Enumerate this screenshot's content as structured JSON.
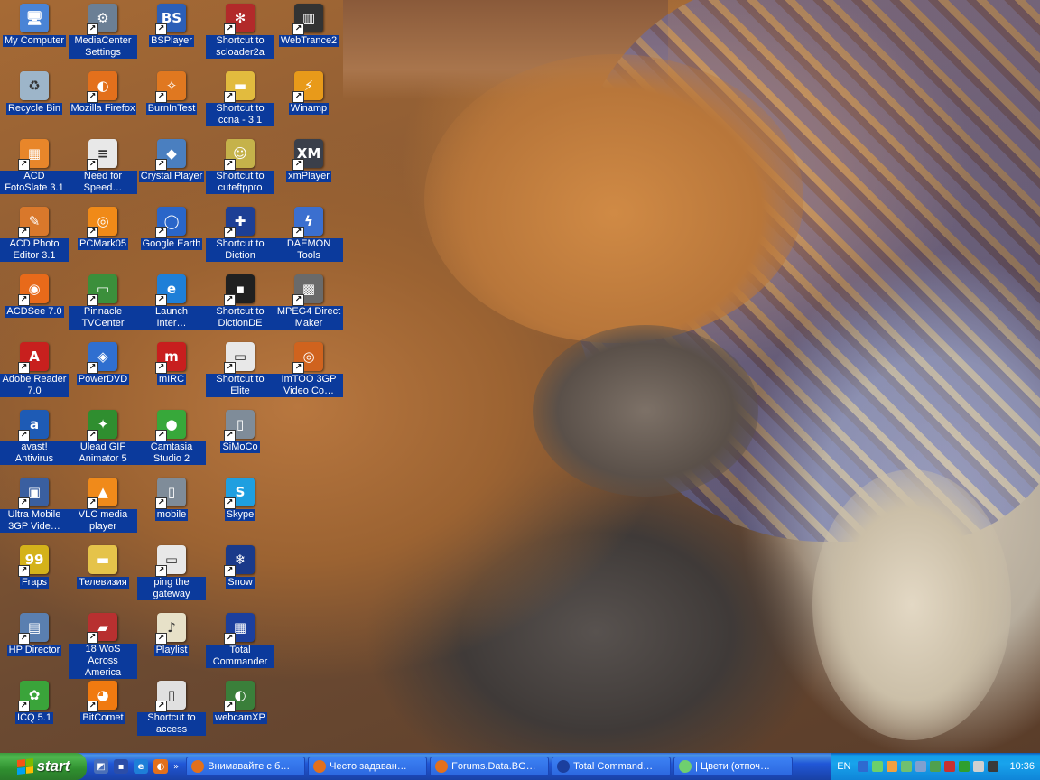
{
  "desktop": {
    "columns": [
      [
        {
          "name": "my-computer",
          "label": "My Computer",
          "color": "#4a84d6",
          "glyph": "🖥",
          "shortcut": false
        },
        {
          "name": "recycle-bin",
          "label": "Recycle Bin",
          "color": "#9db5c9",
          "glyph": "♻",
          "shortcut": false
        },
        {
          "name": "acd-fotoslate",
          "label": "ACD FotoSlate 3.1",
          "color": "#e8862a",
          "glyph": "▦",
          "shortcut": true
        },
        {
          "name": "acd-photo-editor",
          "label": "ACD Photo Editor 3.1",
          "color": "#d9782b",
          "glyph": "✎",
          "shortcut": true
        },
        {
          "name": "acdsee",
          "label": "ACDSee 7.0",
          "color": "#e86a1a",
          "glyph": "◉",
          "shortcut": true
        },
        {
          "name": "adobe-reader",
          "label": "Adobe Reader 7.0",
          "color": "#c8201e",
          "glyph": "A",
          "shortcut": true
        },
        {
          "name": "avast",
          "label": "avast! Antivirus",
          "color": "#1e5bb5",
          "glyph": "a",
          "shortcut": true
        },
        {
          "name": "ultra-mobile-3gp",
          "label": "Ultra Mobile 3GP Vide…",
          "color": "#3a5fa0",
          "glyph": "▣",
          "shortcut": true
        },
        {
          "name": "fraps",
          "label": "Fraps",
          "color": "#d4b21a",
          "glyph": "99",
          "shortcut": true
        },
        {
          "name": "hp-director",
          "label": "HP Director",
          "color": "#5a7fb0",
          "glyph": "▤",
          "shortcut": true
        },
        {
          "name": "icq",
          "label": "ICQ 5.1",
          "color": "#3aa43a",
          "glyph": "✿",
          "shortcut": true
        }
      ],
      [
        {
          "name": "mediacenter-settings",
          "label": "MediaCenter Settings",
          "color": "#6b7f95",
          "glyph": "⚙",
          "shortcut": true
        },
        {
          "name": "mozilla-firefox",
          "label": "Mozilla Firefox",
          "color": "#e3701c",
          "glyph": "◐",
          "shortcut": true
        },
        {
          "name": "need-for-speed",
          "label": "Need for Speed…",
          "color": "#e8e8e8",
          "glyph": "≡",
          "shortcut": true
        },
        {
          "name": "pcmark05",
          "label": "PCMark05",
          "color": "#f08a18",
          "glyph": "◎",
          "shortcut": true
        },
        {
          "name": "pinnacle-tvcenter",
          "label": "Pinnacle TVCenter",
          "color": "#3b8f3b",
          "glyph": "▭",
          "shortcut": true
        },
        {
          "name": "powerdvd",
          "label": "PowerDVD",
          "color": "#2f6fd0",
          "glyph": "◈",
          "shortcut": true
        },
        {
          "name": "ulead-gif-animator",
          "label": "Ulead GIF Animator 5",
          "color": "#2f8e2f",
          "glyph": "✦",
          "shortcut": true
        },
        {
          "name": "vlc-media-player",
          "label": "VLC media player",
          "color": "#f08a1a",
          "glyph": "▲",
          "shortcut": true
        },
        {
          "name": "televizia",
          "label": "Телевизия",
          "color": "#e5c34a",
          "glyph": "▬",
          "shortcut": false
        },
        {
          "name": "18-wos-across-america",
          "label": "18 WoS Across America",
          "color": "#b83030",
          "glyph": "▰",
          "shortcut": true
        },
        {
          "name": "bitcomet",
          "label": "BitComet",
          "color": "#f07a10",
          "glyph": "◕",
          "shortcut": true
        }
      ],
      [
        {
          "name": "bsplayer",
          "label": "BSPlayer",
          "color": "#2b5fb8",
          "glyph": "BS",
          "shortcut": true
        },
        {
          "name": "burnintest",
          "label": "BurnInTest",
          "color": "#e07820",
          "glyph": "✧",
          "shortcut": true
        },
        {
          "name": "crystal-player",
          "label": "Crystal Player",
          "color": "#4a7fc0",
          "glyph": "◆",
          "shortcut": true
        },
        {
          "name": "google-earth",
          "label": "Google Earth",
          "color": "#2a66c9",
          "glyph": "◯",
          "shortcut": true
        },
        {
          "name": "launch-internet",
          "label": "Launch Inter…",
          "color": "#1e7fd8",
          "glyph": "e",
          "shortcut": true
        },
        {
          "name": "mirc",
          "label": "mIRC",
          "color": "#c81e1e",
          "glyph": "m",
          "shortcut": true
        },
        {
          "name": "camtasia-studio",
          "label": "Camtasia Studio 2",
          "color": "#37a83a",
          "glyph": "●",
          "shortcut": true
        },
        {
          "name": "mobile",
          "label": "mobile",
          "color": "#7f8c99",
          "glyph": "▯",
          "shortcut": true
        },
        {
          "name": "ping-the-gateway",
          "label": "ping the gateway",
          "color": "#e8e8e8",
          "glyph": "▭",
          "shortcut": true
        },
        {
          "name": "playlist",
          "label": "Playlist",
          "color": "#e7e1c8",
          "glyph": "♪",
          "shortcut": true
        },
        {
          "name": "shortcut-to-access",
          "label": "Shortcut to access",
          "color": "#e0e0e0",
          "glyph": "▯",
          "shortcut": true
        }
      ],
      [
        {
          "name": "shortcut-to-scloader2a",
          "label": "Shortcut to scloader2a",
          "color": "#b22a2a",
          "glyph": "✻",
          "shortcut": true
        },
        {
          "name": "shortcut-to-ccna",
          "label": "Shortcut to ccna - 3.1",
          "color": "#e2bb3e",
          "glyph": "▬",
          "shortcut": true
        },
        {
          "name": "shortcut-to-cuteftppro",
          "label": "Shortcut to cuteftppro",
          "color": "#c5b24a",
          "glyph": "☺",
          "shortcut": true
        },
        {
          "name": "shortcut-to-diction",
          "label": "Shortcut to Diction",
          "color": "#1d3f95",
          "glyph": "✚",
          "shortcut": true
        },
        {
          "name": "shortcut-to-dictionde",
          "label": "Shortcut to DictionDE",
          "color": "#202020",
          "glyph": "▪",
          "shortcut": true
        },
        {
          "name": "shortcut-to-elite",
          "label": "Shortcut to Elite",
          "color": "#e8e8e8",
          "glyph": "▭",
          "shortcut": true
        },
        {
          "name": "simoco",
          "label": "SiMoCo",
          "color": "#7f8c99",
          "glyph": "▯",
          "shortcut": true
        },
        {
          "name": "skype",
          "label": "Skype",
          "color": "#1f9fe0",
          "glyph": "S",
          "shortcut": true
        },
        {
          "name": "snow",
          "label": "Snow",
          "color": "#1a3a8a",
          "glyph": "❄",
          "shortcut": true
        },
        {
          "name": "total-commander",
          "label": "Total Commander",
          "color": "#1b3f9e",
          "glyph": "▦",
          "shortcut": true
        },
        {
          "name": "webcamxp",
          "label": "webcamXP",
          "color": "#3a7f3a",
          "glyph": "◐",
          "shortcut": true
        }
      ],
      [
        {
          "name": "webtrance2",
          "label": "WebTrance2",
          "color": "#333333",
          "glyph": "▥",
          "shortcut": true
        },
        {
          "name": "winamp",
          "label": "Winamp",
          "color": "#e89a1a",
          "glyph": "⚡",
          "shortcut": true
        },
        {
          "name": "xmplayer",
          "label": "xmPlayer",
          "color": "#3a3f4a",
          "glyph": "XM",
          "shortcut": true
        },
        {
          "name": "daemon-tools",
          "label": "DAEMON Tools",
          "color": "#3b6fcf",
          "glyph": "ϟ",
          "shortcut": true
        },
        {
          "name": "mpeg4-direct-maker",
          "label": "MPEG4 Direct Maker",
          "color": "#6a6a6a",
          "glyph": "▩",
          "shortcut": true
        },
        {
          "name": "imtoo-3gp-video",
          "label": "ImTOO 3GP Video Co…",
          "color": "#d0631e",
          "glyph": "◎",
          "shortcut": true
        }
      ]
    ]
  },
  "taskbar": {
    "start_label": "start",
    "quick_launch": [
      {
        "name": "ql-media-icon",
        "color": "#4a6fb8",
        "glyph": "◩"
      },
      {
        "name": "ql-floppy-icon",
        "color": "#2b4da8",
        "glyph": "▪"
      },
      {
        "name": "ql-ie-icon",
        "color": "#1e7fd8",
        "glyph": "e"
      },
      {
        "name": "ql-firefox-icon",
        "color": "#e3701c",
        "glyph": "◐"
      }
    ],
    "quick_launch_more": "»",
    "tasks": [
      {
        "name": "task-vnimavayte",
        "label": "Внимавайте с б…",
        "color": "#e3701c"
      },
      {
        "name": "task-chesto-zadavan",
        "label": "Често задаван…",
        "color": "#e3701c"
      },
      {
        "name": "task-forums-data-bg",
        "label": "Forums.Data.BG…",
        "color": "#e3701c"
      },
      {
        "name": "task-total-commander",
        "label": "Total Command…",
        "color": "#1b3f9e"
      },
      {
        "name": "task-tsveti",
        "label": "| Цвети (отпоч…",
        "color": "#6fcf6f"
      }
    ],
    "tray": {
      "language": "EN",
      "icons": [
        {
          "name": "tray-chevron-icon",
          "color": "#2e6ad0"
        },
        {
          "name": "tray-check-icon",
          "color": "#6bd06b"
        },
        {
          "name": "tray-orange-icon",
          "color": "#f0a040"
        },
        {
          "name": "tray-network-icon",
          "color": "#70c070"
        },
        {
          "name": "tray-monitor-icon",
          "color": "#7fa0d0"
        },
        {
          "name": "tray-bars-icon",
          "color": "#4fa04f"
        },
        {
          "name": "tray-shield-icon",
          "color": "#c83030"
        },
        {
          "name": "tray-flower-icon",
          "color": "#2f9f2f"
        },
        {
          "name": "tray-speaker-icon",
          "color": "#d0d0d0"
        },
        {
          "name": "tray-app-icon",
          "color": "#3a3a3a"
        }
      ],
      "clock": "10:36"
    }
  },
  "colors": {
    "label_bg": "#0b3a9c",
    "taskbar_blue": "#245edb",
    "start_green": "#3a9a3a",
    "tray_blue": "#0f9ee7"
  }
}
